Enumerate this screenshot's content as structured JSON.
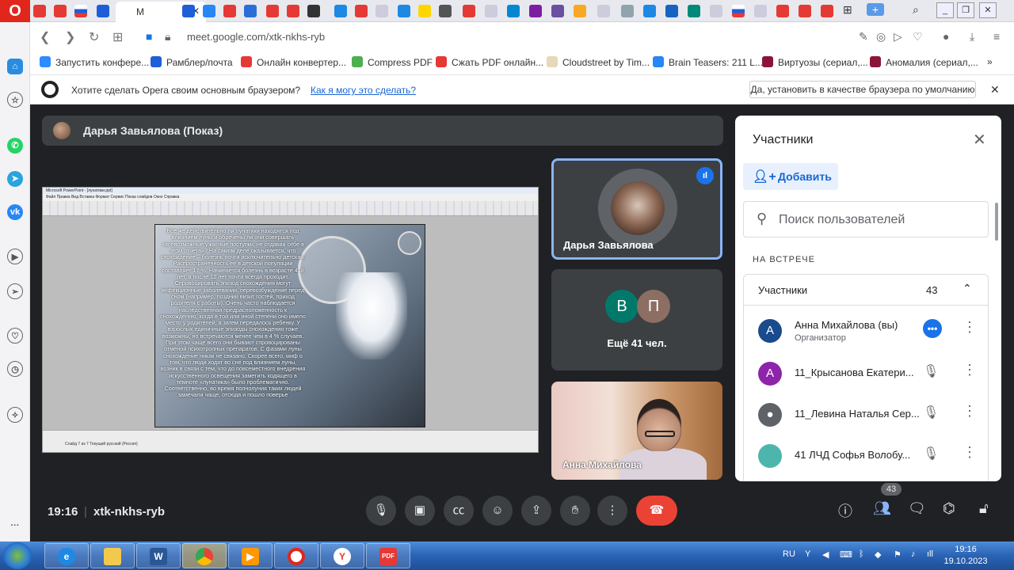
{
  "browser": {
    "active_tab_label": "M",
    "url": "meet.google.com/xtk-nkhs-ryb",
    "bookmarks": [
      "Запустить конфере...",
      "Рамблер/почта",
      "Онлайн конвертер...",
      "Compress PDF",
      "Сжать PDF онлайн...",
      "Cloudstreet by Tim...",
      "Brain Teasers: 211 L...",
      "Виртуозы (сериал,...",
      "Аномалия (сериал,..."
    ],
    "default_prompt": {
      "message": "Хотите сделать Opera своим основным браузером?",
      "link": "Как я могу это сделать?",
      "button": "Да, установить в качестве браузера по умолчанию"
    }
  },
  "meet": {
    "presenter_bar": "Дарья Завьялова (Показ)",
    "tiles": {
      "speaker_name": "Дарья Завьялова",
      "others_initials": [
        "В",
        "П"
      ],
      "others_label": "Ещё 41 чел.",
      "self_name": "Анна Михайлова"
    },
    "slide_text": "Все же действительно ли лунатики находятся под влиянием луны и обречены ли они совершать «всевозможные ужасные поступки, не отдавая себе в этом отчета»? На самом деле оказывается, что снохождение – болезнь почти исключительно детская. Распространенность ее в детской популяции составляет 17 %. Начинается болезнь в возрасте 4–8 лет, а после 12 лет почти всегда проходит. Спровоцировать эпизод снохождения могут инфекционные заболевания, перевозбуждение перед сном (например, поздний визит гостей, приход родителя с работы). Очень часто наблюдается наследственная предрасположенность к снохождению, когда в той или иной степени оно имело место у родителей, а затем передалось ребенку. У взрослых единичные эпизоды снохождения тоже возможны, но встречаются менее чем в 4 % случаев. При этом чаще всего они бывают спровоцированы отменой психотропных препаратов. С фазами луны снохождение никак не связано. Скорее всего, миф о том, что люди ходят во сне под влиянием луны, возник в связи с тем, что до повсеместного внедрения искусственного освещения заметить ходящего в темноте «лунатика» было проблематично. Соответственно, во время полнолуния таких людей замечали чаще, отсюда и пошло поверье",
    "ppt": {
      "title": "Microsoft PowerPoint - [лунатики.ppt]",
      "menu": "Файл  Правка  Вид  Вставка  Формат  Сервис  Показ слайдов  Окно  Справка",
      "status": "Слайд 7 из 7      Текущий      русский (Россия)"
    },
    "participants": {
      "title": "Участники",
      "add_label": "Добавить",
      "search_placeholder": "Поиск пользователей",
      "section": "НА ВСТРЕЧЕ",
      "group_label": "Участники",
      "count": "43",
      "people": [
        {
          "initial": "А",
          "name": "Анна Михайлова (вы)",
          "role": "Организатор",
          "color": "#1a4b8c"
        },
        {
          "initial": "А",
          "name": "11_Крысанова Екатери...",
          "role": "",
          "color": "#8e24aa"
        },
        {
          "initial": "",
          "name": "11_Левина Наталья Сер...",
          "role": "",
          "color": "#5f6368"
        },
        {
          "initial": "",
          "name": "41 ЛЧД Софья Волобу...",
          "role": "",
          "color": "#4db6ac"
        }
      ]
    },
    "control": {
      "time": "19:16",
      "separator": "|",
      "code": "xtk-nkhs-ryb",
      "people_badge": "43"
    }
  },
  "taskbar": {
    "lang": "RU",
    "time": "19:16",
    "date": "19.10.2023"
  },
  "colors": {
    "meet_bg": "#202124",
    "accent": "#1a73e8",
    "end_call": "#ea4335",
    "opera": "#e1261c"
  }
}
